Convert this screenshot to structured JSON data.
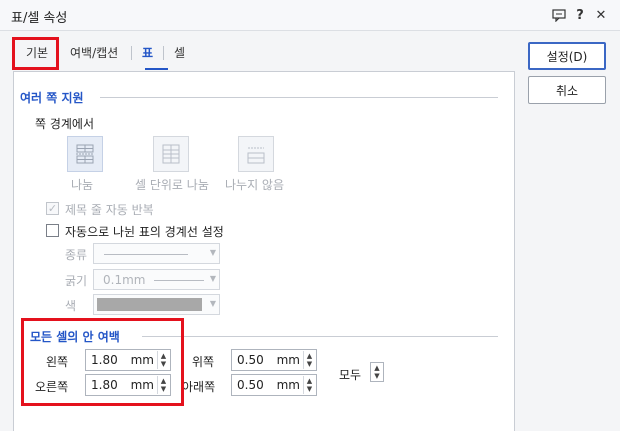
{
  "window": {
    "title": "표/셀 속성"
  },
  "tabs": [
    {
      "label": "기본"
    },
    {
      "label": "여백/캡션"
    },
    {
      "label": "표"
    },
    {
      "label": "셀"
    }
  ],
  "buttons": {
    "ok": "설정(D)",
    "cancel": "취소"
  },
  "multi_page": {
    "title": "여러 쪽 지원",
    "boundary_label": "쪽 경계에서",
    "options": [
      {
        "label": "나눔",
        "icon": "split-table-icon"
      },
      {
        "label": "셀 단위로 나눔",
        "icon": "split-by-cell-icon"
      },
      {
        "label": "나누지 않음",
        "icon": "no-split-icon"
      }
    ],
    "repeat_title": {
      "label": "제목 줄 자동 반복",
      "checked": true,
      "enabled": false
    },
    "auto_border": {
      "label": "자동으로 나뉜 표의 경계선 설정",
      "checked": false,
      "enabled": true
    },
    "line_type": {
      "label": "종류"
    },
    "line_width": {
      "label": "굵기",
      "value": "0.1mm"
    },
    "line_color": {
      "label": "색",
      "value": "#a8a8a8"
    }
  },
  "cell_margin": {
    "title": "모든 셀의 안 여백",
    "left": {
      "label": "왼쪽",
      "value": "1.80",
      "unit": "mm"
    },
    "right": {
      "label": "오른쪽",
      "value": "1.80",
      "unit": "mm"
    },
    "top": {
      "label": "위쪽",
      "value": "0.50",
      "unit": "mm"
    },
    "bottom": {
      "label": "아래쪽",
      "value": "0.50",
      "unit": "mm"
    },
    "all": {
      "label": "모두"
    }
  },
  "colors": {
    "accent": "#2456c7",
    "highlight": "#e4111d"
  }
}
